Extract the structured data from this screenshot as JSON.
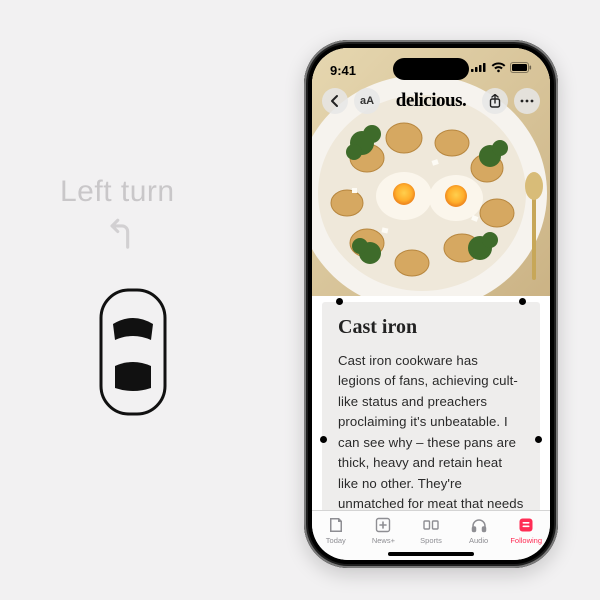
{
  "driving": {
    "caption": "Left turn"
  },
  "status": {
    "time": "9:41"
  },
  "header": {
    "brand": "delicious."
  },
  "article": {
    "title": "Cast iron",
    "body": "Cast iron cookware has legions of fans, achieving cult-like status and preachers proclaiming it's unbeatable. I can see why – these pans are thick, heavy and retain heat like no other. They're unmatched for meat that needs a strong sear; hav-"
  },
  "tabs": [
    {
      "label": "Today"
    },
    {
      "label": "News+"
    },
    {
      "label": "Sports"
    },
    {
      "label": "Audio"
    },
    {
      "label": "Following"
    }
  ],
  "colors": {
    "accent": "#ff2d55"
  }
}
